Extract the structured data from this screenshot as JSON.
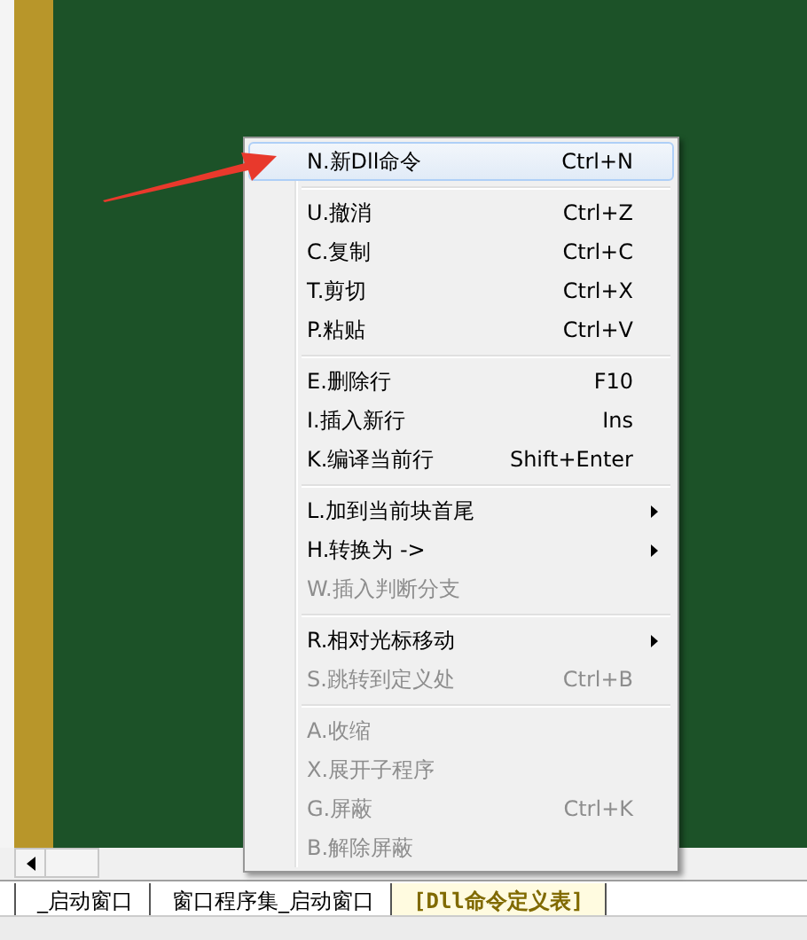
{
  "context_menu": {
    "items": [
      {
        "kind": "item",
        "label": "N.新Dll命令",
        "shortcut": "Ctrl+N",
        "submenu": false,
        "disabled": false,
        "selected": true
      },
      {
        "kind": "separator"
      },
      {
        "kind": "item",
        "label": "U.撤消",
        "shortcut": "Ctrl+Z",
        "submenu": false,
        "disabled": false,
        "selected": false
      },
      {
        "kind": "item",
        "label": "C.复制",
        "shortcut": "Ctrl+C",
        "submenu": false,
        "disabled": false,
        "selected": false
      },
      {
        "kind": "item",
        "label": "T.剪切",
        "shortcut": "Ctrl+X",
        "submenu": false,
        "disabled": false,
        "selected": false
      },
      {
        "kind": "item",
        "label": "P.粘贴",
        "shortcut": "Ctrl+V",
        "submenu": false,
        "disabled": false,
        "selected": false
      },
      {
        "kind": "separator"
      },
      {
        "kind": "item",
        "label": "E.删除行",
        "shortcut": "F10",
        "submenu": false,
        "disabled": false,
        "selected": false
      },
      {
        "kind": "item",
        "label": "I.插入新行",
        "shortcut": "Ins",
        "submenu": false,
        "disabled": false,
        "selected": false
      },
      {
        "kind": "item",
        "label": "K.编译当前行",
        "shortcut": "Shift+Enter",
        "submenu": false,
        "disabled": false,
        "selected": false
      },
      {
        "kind": "separator"
      },
      {
        "kind": "item",
        "label": "L.加到当前块首尾",
        "submenu": true,
        "disabled": false,
        "selected": false
      },
      {
        "kind": "item",
        "label": "H.转换为 ->",
        "submenu": true,
        "disabled": false,
        "selected": false
      },
      {
        "kind": "item",
        "label": "W.插入判断分支",
        "submenu": false,
        "disabled": true,
        "selected": false
      },
      {
        "kind": "separator"
      },
      {
        "kind": "item",
        "label": "R.相对光标移动",
        "submenu": true,
        "disabled": false,
        "selected": false
      },
      {
        "kind": "item",
        "label": "S.跳转到定义处",
        "shortcut": "Ctrl+B",
        "submenu": false,
        "disabled": true,
        "selected": false
      },
      {
        "kind": "separator"
      },
      {
        "kind": "item",
        "label": "A.收缩",
        "submenu": false,
        "disabled": true,
        "selected": false
      },
      {
        "kind": "item",
        "label": "X.展开子程序",
        "submenu": false,
        "disabled": true,
        "selected": false
      },
      {
        "kind": "item",
        "label": "G.屏蔽",
        "shortcut": "Ctrl+K",
        "submenu": false,
        "disabled": true,
        "selected": false
      },
      {
        "kind": "item",
        "label": "B.解除屏蔽",
        "submenu": false,
        "disabled": true,
        "selected": false
      }
    ]
  },
  "tabs": [
    {
      "label": "_启动窗口",
      "selected": false
    },
    {
      "label": "窗口程序集_启动窗口",
      "selected": false
    },
    {
      "label": "[Dll命令定义表]",
      "selected": true
    }
  ]
}
